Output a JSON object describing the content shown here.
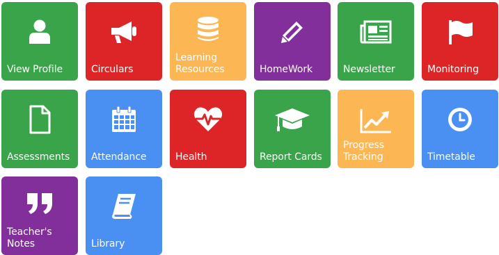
{
  "colors": {
    "green": "#3aa44a",
    "red": "#dd2528",
    "orange": "#fcb754",
    "purple": "#822e9b",
    "blue": "#4a8ff2"
  },
  "tiles": [
    {
      "label": "View Profile",
      "icon": "user-icon",
      "color": "green"
    },
    {
      "label": "Circulars",
      "icon": "megaphone-icon",
      "color": "red"
    },
    {
      "label": "Learning Resources",
      "icon": "database-icon",
      "color": "orange"
    },
    {
      "label": "HomeWork",
      "icon": "pencil-icon",
      "color": "purple"
    },
    {
      "label": "Newsletter",
      "icon": "newspaper-icon",
      "color": "green"
    },
    {
      "label": "Monitoring",
      "icon": "flag-icon",
      "color": "red"
    },
    {
      "label": "Assessments",
      "icon": "document-icon",
      "color": "green"
    },
    {
      "label": "Attendance",
      "icon": "calendar-icon",
      "color": "blue"
    },
    {
      "label": "Health",
      "icon": "heartbeat-icon",
      "color": "red"
    },
    {
      "label": "Report Cards",
      "icon": "graduation-cap-icon",
      "color": "green"
    },
    {
      "label": "Progress Tracking",
      "icon": "line-chart-icon",
      "color": "orange"
    },
    {
      "label": "Timetable",
      "icon": "clock-icon",
      "color": "blue"
    },
    {
      "label": "Teacher's Notes",
      "icon": "quote-icon",
      "color": "purple"
    },
    {
      "label": "Library",
      "icon": "book-icon",
      "color": "blue"
    }
  ]
}
